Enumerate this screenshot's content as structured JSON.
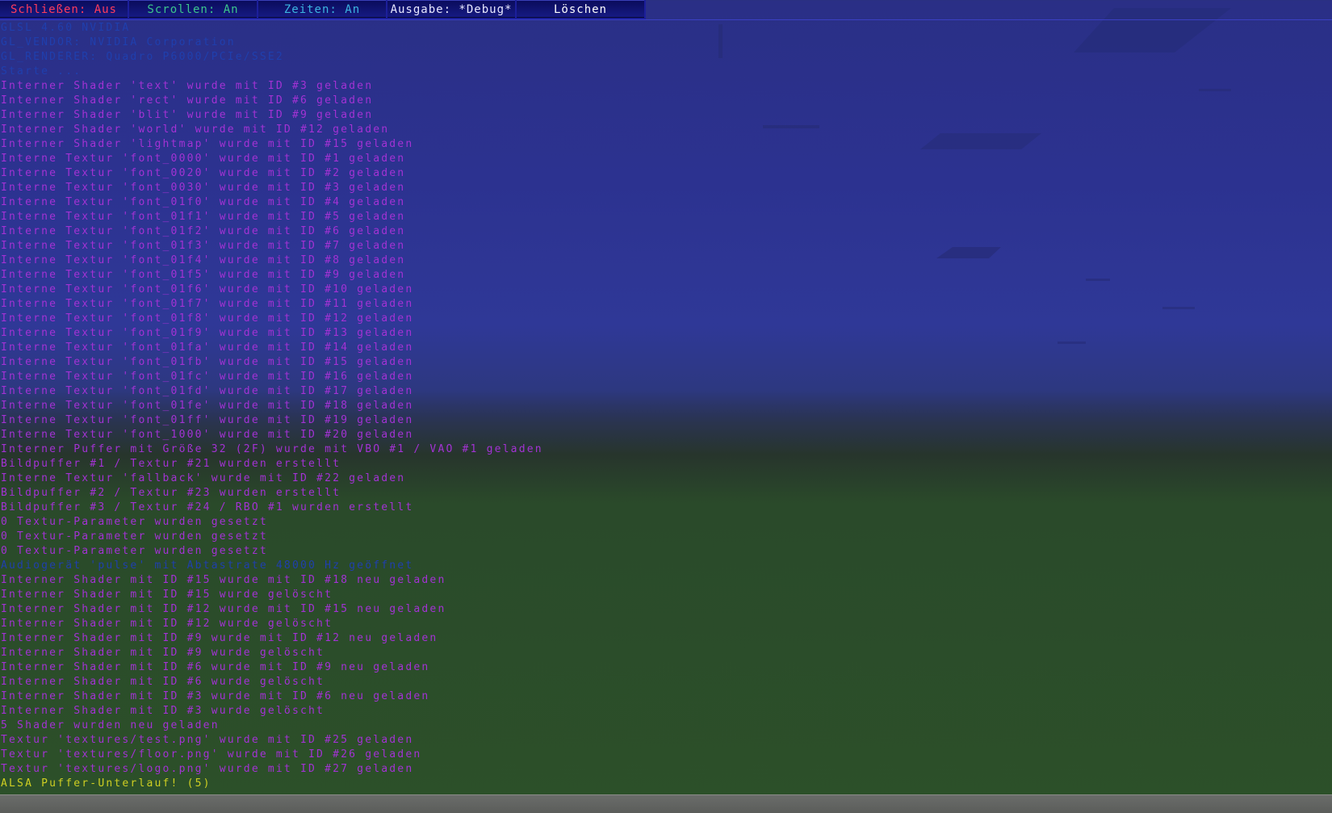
{
  "colors": {
    "close": "#ff3c5c",
    "scroll": "#3cc48c",
    "times": "#3cb4e0",
    "output": "#e8e8ff",
    "clear": "#ffffff",
    "dim": "#1f3fae",
    "magenta": "#a332d4",
    "warn": "#cfcf22"
  },
  "toolbar": {
    "close_label": "Schließen: Aus",
    "scroll_label": "Scrollen: An",
    "times_label": "Zeiten: An",
    "output_label": "Ausgabe: *Debug*",
    "clear_label": "Löschen"
  },
  "console": {
    "lines": [
      {
        "text": "GLSL 4.60 NVIDIA",
        "color": "dim"
      },
      {
        "text": "GL_VENDOR: NVIDIA Corporation",
        "color": "dim"
      },
      {
        "text": "GL_RENDERER: Quadro P6000/PCIe/SSE2",
        "color": "dim"
      },
      {
        "text": "Starte ...",
        "color": "dim"
      },
      {
        "text": "Interner Shader 'text' wurde mit ID #3 geladen",
        "color": "magenta"
      },
      {
        "text": "Interner Shader 'rect' wurde mit ID #6 geladen",
        "color": "magenta"
      },
      {
        "text": "Interner Shader 'blit' wurde mit ID #9 geladen",
        "color": "magenta"
      },
      {
        "text": "Interner Shader 'world' wurde mit ID #12 geladen",
        "color": "magenta"
      },
      {
        "text": "Interner Shader 'lightmap' wurde mit ID #15 geladen",
        "color": "magenta"
      },
      {
        "text": "Interne Textur 'font_0000' wurde mit ID #1 geladen",
        "color": "magenta"
      },
      {
        "text": "Interne Textur 'font_0020' wurde mit ID #2 geladen",
        "color": "magenta"
      },
      {
        "text": "Interne Textur 'font_0030' wurde mit ID #3 geladen",
        "color": "magenta"
      },
      {
        "text": "Interne Textur 'font_01f0' wurde mit ID #4 geladen",
        "color": "magenta"
      },
      {
        "text": "Interne Textur 'font_01f1' wurde mit ID #5 geladen",
        "color": "magenta"
      },
      {
        "text": "Interne Textur 'font_01f2' wurde mit ID #6 geladen",
        "color": "magenta"
      },
      {
        "text": "Interne Textur 'font_01f3' wurde mit ID #7 geladen",
        "color": "magenta"
      },
      {
        "text": "Interne Textur 'font_01f4' wurde mit ID #8 geladen",
        "color": "magenta"
      },
      {
        "text": "Interne Textur 'font_01f5' wurde mit ID #9 geladen",
        "color": "magenta"
      },
      {
        "text": "Interne Textur 'font_01f6' wurde mit ID #10 geladen",
        "color": "magenta"
      },
      {
        "text": "Interne Textur 'font_01f7' wurde mit ID #11 geladen",
        "color": "magenta"
      },
      {
        "text": "Interne Textur 'font_01f8' wurde mit ID #12 geladen",
        "color": "magenta"
      },
      {
        "text": "Interne Textur 'font_01f9' wurde mit ID #13 geladen",
        "color": "magenta"
      },
      {
        "text": "Interne Textur 'font_01fa' wurde mit ID #14 geladen",
        "color": "magenta"
      },
      {
        "text": "Interne Textur 'font_01fb' wurde mit ID #15 geladen",
        "color": "magenta"
      },
      {
        "text": "Interne Textur 'font_01fc' wurde mit ID #16 geladen",
        "color": "magenta"
      },
      {
        "text": "Interne Textur 'font_01fd' wurde mit ID #17 geladen",
        "color": "magenta"
      },
      {
        "text": "Interne Textur 'font_01fe' wurde mit ID #18 geladen",
        "color": "magenta"
      },
      {
        "text": "Interne Textur 'font_01ff' wurde mit ID #19 geladen",
        "color": "magenta"
      },
      {
        "text": "Interne Textur 'font_1000' wurde mit ID #20 geladen",
        "color": "magenta"
      },
      {
        "text": "Interner Puffer mit Größe 32 (2F) wurde mit VBO #1 / VAO #1 geladen",
        "color": "magenta"
      },
      {
        "text": "Bildpuffer #1 / Textur #21 wurden erstellt",
        "color": "magenta"
      },
      {
        "text": "Interne Textur 'fallback' wurde mit ID #22 geladen",
        "color": "magenta"
      },
      {
        "text": "Bildpuffer #2 / Textur #23 wurden erstellt",
        "color": "magenta"
      },
      {
        "text": "Bildpuffer #3 / Textur #24 / RBO #1 wurden erstellt",
        "color": "magenta"
      },
      {
        "text": "0 Textur-Parameter wurden gesetzt",
        "color": "magenta"
      },
      {
        "text": "0 Textur-Parameter wurden gesetzt",
        "color": "magenta"
      },
      {
        "text": "0 Textur-Parameter wurden gesetzt",
        "color": "magenta"
      },
      {
        "text": "Audiogerät 'pulse' mit Abtastrate 48000 Hz geöffnet",
        "color": "dim"
      },
      {
        "text": "Interner Shader mit ID #15 wurde mit ID #18 neu geladen",
        "color": "magenta"
      },
      {
        "text": "Interner Shader mit ID #15 wurde gelöscht",
        "color": "magenta"
      },
      {
        "text": "Interner Shader mit ID #12 wurde mit ID #15 neu geladen",
        "color": "magenta"
      },
      {
        "text": "Interner Shader mit ID #12 wurde gelöscht",
        "color": "magenta"
      },
      {
        "text": "Interner Shader mit ID #9 wurde mit ID #12 neu geladen",
        "color": "magenta"
      },
      {
        "text": "Interner Shader mit ID #9 wurde gelöscht",
        "color": "magenta"
      },
      {
        "text": "Interner Shader mit ID #6 wurde mit ID #9 neu geladen",
        "color": "magenta"
      },
      {
        "text": "Interner Shader mit ID #6 wurde gelöscht",
        "color": "magenta"
      },
      {
        "text": "Interner Shader mit ID #3 wurde mit ID #6 neu geladen",
        "color": "magenta"
      },
      {
        "text": "Interner Shader mit ID #3 wurde gelöscht",
        "color": "magenta"
      },
      {
        "text": "5 Shader wurden neu geladen",
        "color": "magenta"
      },
      {
        "text": "Textur 'textures/test.png' wurde mit ID #25 geladen",
        "color": "magenta"
      },
      {
        "text": "Textur 'textures/floor.png' wurde mit ID #26 geladen",
        "color": "magenta"
      },
      {
        "text": "Textur 'textures/logo.png' wurde mit ID #27 geladen",
        "color": "magenta"
      },
      {
        "text": "ALSA Puffer-Unterlauf! (5)",
        "color": "warn"
      }
    ]
  }
}
